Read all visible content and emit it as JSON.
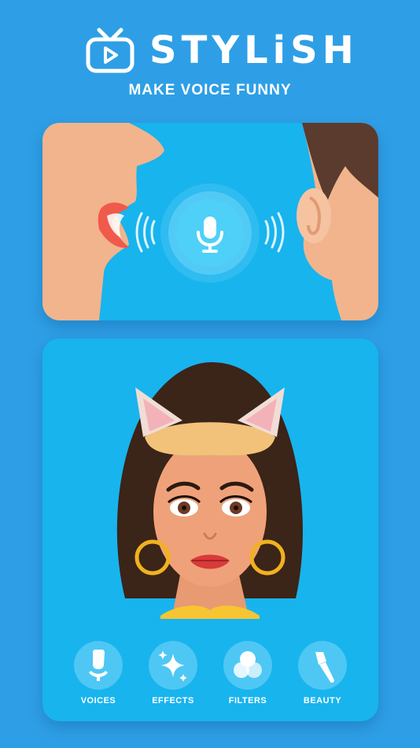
{
  "app": {
    "title": "STYLiSH",
    "subtitle": "MAKE VOICE FUNNY",
    "logo_icon": "tv-play-icon"
  },
  "colors": {
    "background": "#2e9fe6",
    "card": "#18b4ee",
    "accent": "#4ec7f5",
    "text": "#ffffff"
  },
  "voice_card": {
    "mic_icon": "microphone-icon"
  },
  "menu": {
    "items": [
      {
        "label": "VOICES",
        "icon": "voice-person-icon"
      },
      {
        "label": "EFFECTS",
        "icon": "sparkle-icon"
      },
      {
        "label": "FILTERS",
        "icon": "filter-circles-icon"
      },
      {
        "label": "BEAUTY",
        "icon": "makeup-brush-icon"
      }
    ]
  }
}
